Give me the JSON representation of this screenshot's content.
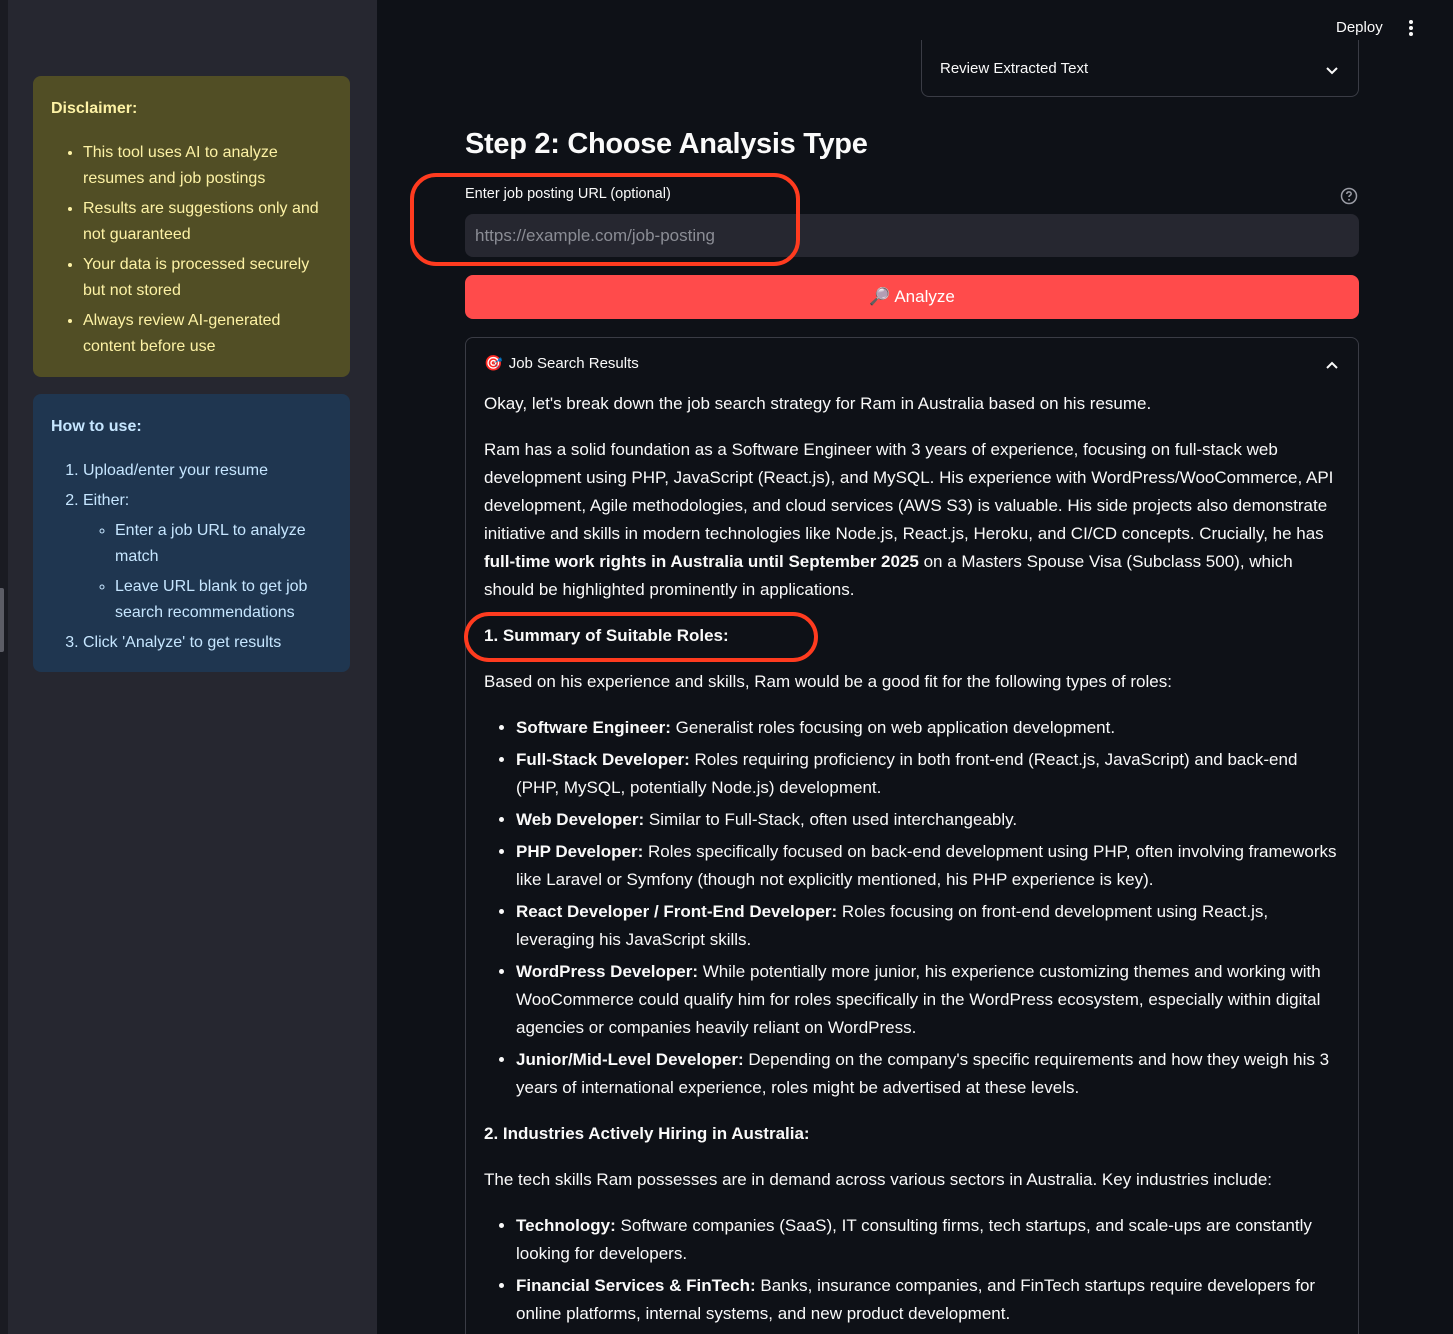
{
  "sidebar": {
    "disclaimer": {
      "title": "Disclaimer:",
      "items": [
        "This tool uses AI to analyze resumes and job postings",
        "Results are suggestions only and not guaranteed",
        "Your data is processed securely but not stored",
        "Always review AI-generated content before use"
      ]
    },
    "howto": {
      "title": "How to use:",
      "step1": "Upload/enter your resume",
      "step2": "Either:",
      "step2_sub": [
        "Enter a job URL to analyze match",
        "Leave URL blank to get job search recommendations"
      ],
      "step3": "Click 'Analyze' to get results"
    }
  },
  "header": {
    "deploy_label": "Deploy",
    "menu_icon": "vertical-ellipsis-icon"
  },
  "main": {
    "review_expander_label": "Review Extracted Text",
    "step_title": "Step 2: Choose Analysis Type",
    "url_field": {
      "label": "Enter job posting URL (optional)",
      "placeholder": "https://example.com/job-posting",
      "value": ""
    },
    "analyze_button": {
      "icon": "🔎",
      "label": "Analyze"
    },
    "results": {
      "icon": "🎯",
      "title": "Job Search Results",
      "intro": "Okay, let's break down the job search strategy for Ram in Australia based on his resume.",
      "para2_a": "Ram has a solid foundation as a Software Engineer with 3 years of experience, focusing on full-stack web development using PHP, JavaScript (React.js), and MySQL. His experience with WordPress/WooCommerce, API development, Agile methodologies, and cloud services (AWS S3) is valuable. His side projects also demonstrate initiative and skills in modern technologies like Node.js, React.js, Heroku, and CI/CD concepts. Crucially, he has ",
      "para2_bold": "full-time work rights in Australia until September 2025",
      "para2_b": " on a Masters Spouse Visa (Subclass 500), which should be highlighted prominently in applications.",
      "section1_heading": "1. Summary of Suitable Roles:",
      "section1_intro": "Based on his experience and skills, Ram would be a good fit for the following types of roles:",
      "roles": [
        {
          "title": "Software Engineer:",
          "desc": " Generalist roles focusing on web application development."
        },
        {
          "title": "Full-Stack Developer:",
          "desc": " Roles requiring proficiency in both front-end (React.js, JavaScript) and back-end (PHP, MySQL, potentially Node.js) development."
        },
        {
          "title": "Web Developer:",
          "desc": " Similar to Full-Stack, often used interchangeably."
        },
        {
          "title": "PHP Developer:",
          "desc": " Roles specifically focused on back-end development using PHP, often involving frameworks like Laravel or Symfony (though not explicitly mentioned, his PHP experience is key)."
        },
        {
          "title": "React Developer / Front-End Developer:",
          "desc": " Roles focusing on front-end development using React.js, leveraging his JavaScript skills."
        },
        {
          "title": "WordPress Developer:",
          "desc": " While potentially more junior, his experience customizing themes and working with WooCommerce could qualify him for roles specifically in the WordPress ecosystem, especially within digital agencies or companies heavily reliant on WordPress."
        },
        {
          "title": "Junior/Mid-Level Developer:",
          "desc": " Depending on the company's specific requirements and how they weigh his 3 years of international experience, roles might be advertised at these levels."
        }
      ],
      "section2_heading": "2. Industries Actively Hiring in Australia:",
      "section2_intro": "The tech skills Ram possesses are in demand across various sectors in Australia. Key industries include:",
      "industries": [
        {
          "title": "Technology:",
          "desc": " Software companies (SaaS), IT consulting firms, tech startups, and scale-ups are constantly looking for developers."
        },
        {
          "title": "Financial Services & FinTech:",
          "desc": " Banks, insurance companies, and FinTech startups require developers for online platforms, internal systems, and new product development."
        }
      ]
    }
  },
  "colors": {
    "page_bg": "#0e1117",
    "sidebar_bg": "#262730",
    "primary_button": "#ff4b4b",
    "warning_bg": "#514e25",
    "info_bg": "#1f3650",
    "annotation_ring": "#ff3b1f"
  }
}
